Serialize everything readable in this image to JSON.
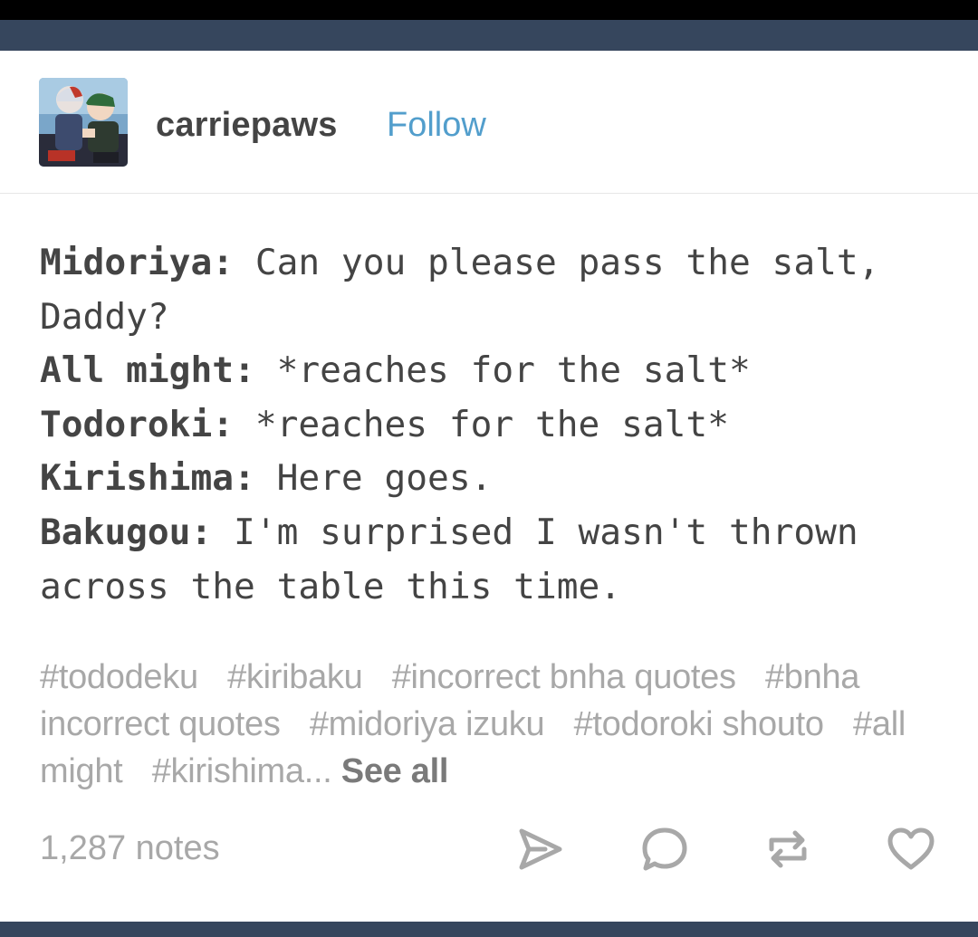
{
  "post": {
    "author": "carriepaws",
    "follow_label": "Follow",
    "dialogue": [
      {
        "speaker": "Midoriya:",
        "text": "Can you please pass the salt, Daddy?"
      },
      {
        "speaker": "All might:",
        "text": "*reaches for the salt*"
      },
      {
        "speaker": "Todoroki:",
        "text": "*reaches for the salt*"
      },
      {
        "speaker": "Kirishima:",
        "text": "Here goes."
      },
      {
        "speaker": "Bakugou:",
        "text": "I'm surprised I wasn't thrown across the table this time."
      }
    ],
    "tags": [
      "#tododeku",
      "#kiribaku",
      "#incorrect bnha quotes",
      "#bnha incorrect quotes",
      "#midoriya izuku",
      "#todoroki shouto",
      "#all might",
      "#kirishima..."
    ],
    "see_all_label": "See all",
    "notes_label": "1,287 notes"
  },
  "actions": [
    {
      "name": "share",
      "icon": "paper-plane-icon"
    },
    {
      "name": "reply",
      "icon": "speech-bubble-icon"
    },
    {
      "name": "reblog",
      "icon": "reblog-icon"
    },
    {
      "name": "like",
      "icon": "heart-icon"
    }
  ],
  "colors": {
    "dashboard_bg": "#36465d",
    "text_primary": "#444444",
    "follow_link": "#529ecc",
    "muted_text": "#a8a8a8",
    "icon_gray": "#a8a8a8"
  }
}
